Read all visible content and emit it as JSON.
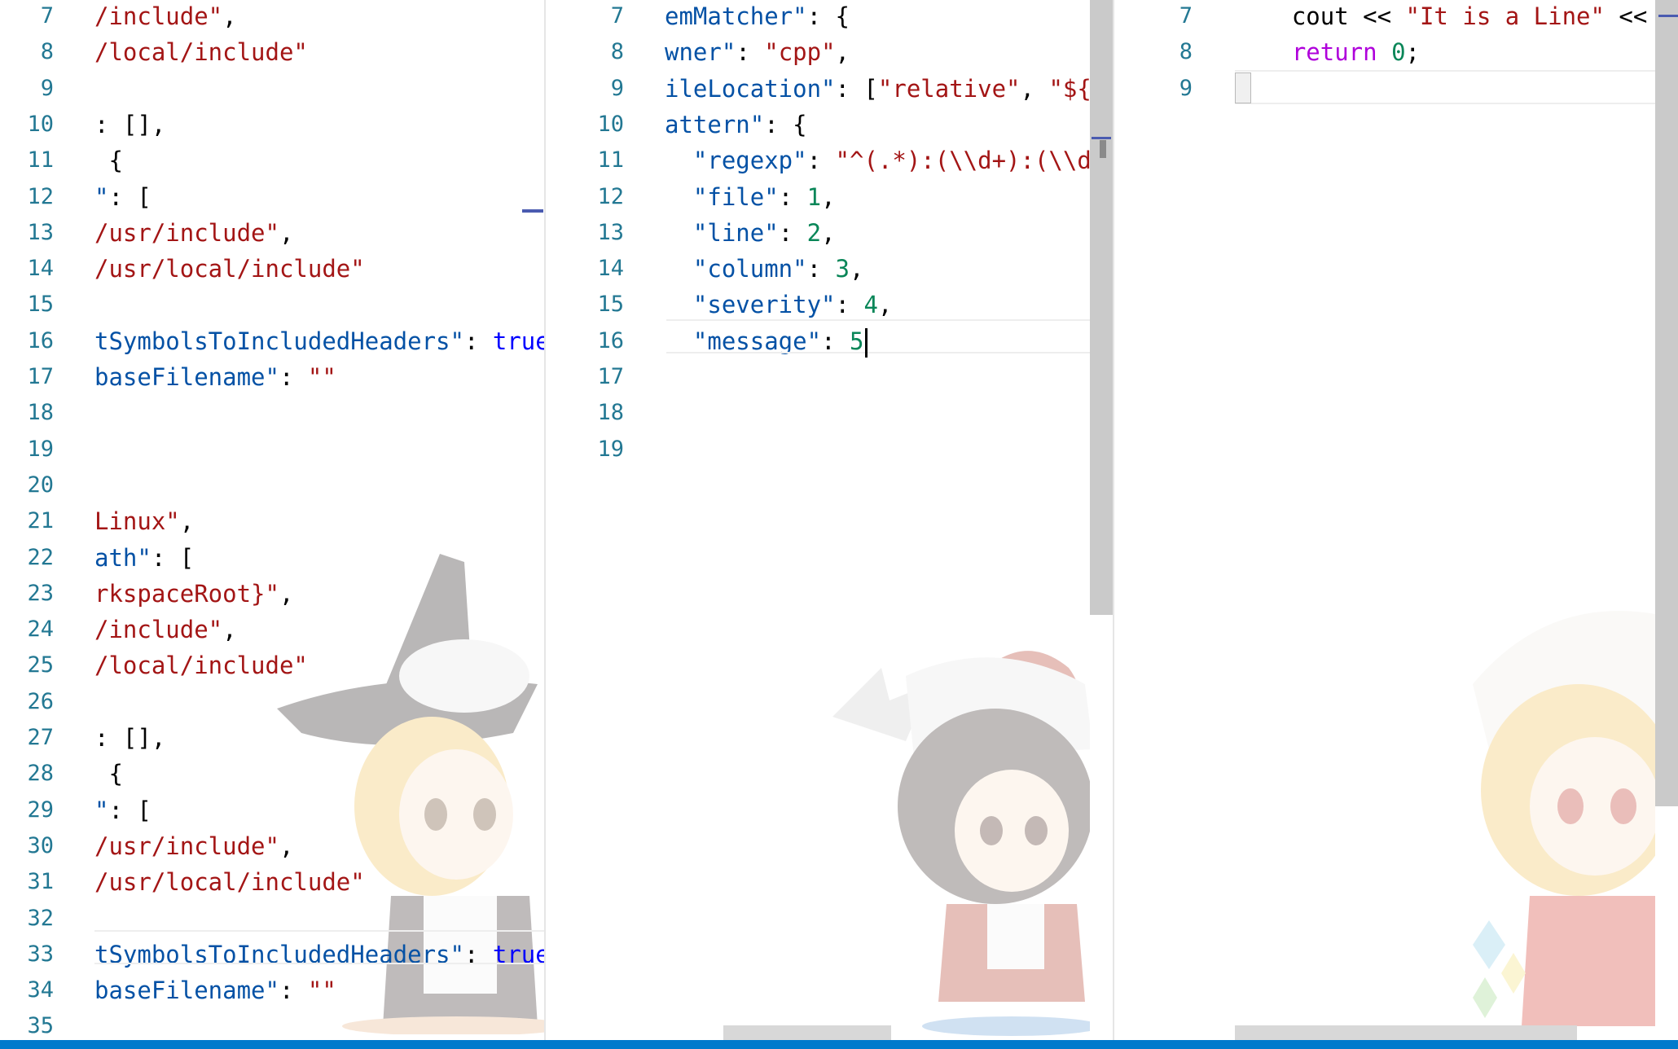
{
  "editor": {
    "colors": {
      "line_number": "#237893",
      "json_key": "#0451a5",
      "string": "#a31515",
      "number": "#098658",
      "keyword": "#0000ff",
      "control": "#af00db",
      "status_bar": "#007acc"
    },
    "panes": [
      {
        "name": "left",
        "lines": [
          {
            "n": "7",
            "parts": [
              {
                "t": "/include\"",
                "c": "str"
              },
              {
                "t": ","
              }
            ]
          },
          {
            "n": "8",
            "parts": [
              {
                "t": "/local/include\"",
                "c": "str"
              }
            ]
          },
          {
            "n": "9",
            "parts": []
          },
          {
            "n": "10",
            "parts": [
              {
                "t": ": [],"
              }
            ]
          },
          {
            "n": "11",
            "parts": [
              {
                "t": " {"
              }
            ]
          },
          {
            "n": "12",
            "parts": [
              {
                "t": "\"",
                "c": "blue"
              },
              {
                "t": ": ["
              }
            ]
          },
          {
            "n": "13",
            "parts": [
              {
                "t": "/usr/include\"",
                "c": "str"
              },
              {
                "t": ","
              }
            ]
          },
          {
            "n": "14",
            "parts": [
              {
                "t": "/usr/local/include\"",
                "c": "str"
              }
            ]
          },
          {
            "n": "15",
            "parts": []
          },
          {
            "n": "16",
            "parts": [
              {
                "t": "tSymbolsToIncludedHeaders\"",
                "c": "blue"
              },
              {
                "t": ": "
              },
              {
                "t": "true",
                "c": "kw"
              }
            ]
          },
          {
            "n": "17",
            "parts": [
              {
                "t": "baseFilename\"",
                "c": "blue"
              },
              {
                "t": ": "
              },
              {
                "t": "\"\"",
                "c": "str"
              }
            ]
          },
          {
            "n": "18",
            "parts": []
          },
          {
            "n": "19",
            "parts": []
          },
          {
            "n": "20",
            "parts": []
          },
          {
            "n": "21",
            "parts": [
              {
                "t": "Linux\"",
                "c": "str"
              },
              {
                "t": ","
              }
            ]
          },
          {
            "n": "22",
            "parts": [
              {
                "t": "ath\"",
                "c": "blue"
              },
              {
                "t": ": ["
              }
            ]
          },
          {
            "n": "23",
            "parts": [
              {
                "t": "rkspaceRoot}\"",
                "c": "str"
              },
              {
                "t": ","
              }
            ]
          },
          {
            "n": "24",
            "parts": [
              {
                "t": "/include\"",
                "c": "str"
              },
              {
                "t": ","
              }
            ]
          },
          {
            "n": "25",
            "parts": [
              {
                "t": "/local/include\"",
                "c": "str"
              }
            ]
          },
          {
            "n": "26",
            "parts": []
          },
          {
            "n": "27",
            "parts": [
              {
                "t": ": [],"
              }
            ]
          },
          {
            "n": "28",
            "parts": [
              {
                "t": " {"
              }
            ]
          },
          {
            "n": "29",
            "parts": [
              {
                "t": "\"",
                "c": "blue"
              },
              {
                "t": ": ["
              }
            ]
          },
          {
            "n": "30",
            "parts": [
              {
                "t": "/usr/include\"",
                "c": "str"
              },
              {
                "t": ","
              }
            ]
          },
          {
            "n": "31",
            "parts": [
              {
                "t": "/usr/local/include\"",
                "c": "str"
              }
            ]
          },
          {
            "n": "32",
            "parts": []
          },
          {
            "n": "33",
            "parts": [
              {
                "t": "tSymbolsToIncludedHeaders\"",
                "c": "blue"
              },
              {
                "t": ": "
              },
              {
                "t": "true",
                "c": "kw"
              }
            ]
          },
          {
            "n": "34",
            "parts": [
              {
                "t": "baseFilename\"",
                "c": "blue"
              },
              {
                "t": ": "
              },
              {
                "t": "\"\"",
                "c": "str"
              }
            ]
          },
          {
            "n": "35",
            "parts": []
          }
        ]
      },
      {
        "name": "middle",
        "lines": [
          {
            "n": "7",
            "parts": [
              {
                "t": "emMatcher\"",
                "c": "blue"
              },
              {
                "t": ": {"
              }
            ]
          },
          {
            "n": "8",
            "parts": [
              {
                "t": "wner\"",
                "c": "blue"
              },
              {
                "t": ": "
              },
              {
                "t": "\"cpp\"",
                "c": "str"
              },
              {
                "t": ","
              }
            ]
          },
          {
            "n": "9",
            "parts": [
              {
                "t": "ileLocation\"",
                "c": "blue"
              },
              {
                "t": ": ["
              },
              {
                "t": "\"relative\"",
                "c": "str"
              },
              {
                "t": ", "
              },
              {
                "t": "\"${wo",
                "c": "str"
              }
            ]
          },
          {
            "n": "10",
            "parts": [
              {
                "t": "attern\"",
                "c": "blue"
              },
              {
                "t": ": {"
              }
            ]
          },
          {
            "n": "11",
            "parts": [
              {
                "t": "  \"regexp\"",
                "c": "blue"
              },
              {
                "t": ": "
              },
              {
                "t": "\"^(.*):(\\\\d+):(\\\\d+)",
                "c": "str"
              }
            ]
          },
          {
            "n": "12",
            "parts": [
              {
                "t": "  \"file\"",
                "c": "blue"
              },
              {
                "t": ": "
              },
              {
                "t": "1",
                "c": "num"
              },
              {
                "t": ","
              }
            ]
          },
          {
            "n": "13",
            "parts": [
              {
                "t": "  \"line\"",
                "c": "blue"
              },
              {
                "t": ": "
              },
              {
                "t": "2",
                "c": "num"
              },
              {
                "t": ","
              }
            ]
          },
          {
            "n": "14",
            "parts": [
              {
                "t": "  \"column\"",
                "c": "blue"
              },
              {
                "t": ": "
              },
              {
                "t": "3",
                "c": "num"
              },
              {
                "t": ","
              }
            ]
          },
          {
            "n": "15",
            "parts": [
              {
                "t": "  \"severity\"",
                "c": "blue"
              },
              {
                "t": ": "
              },
              {
                "t": "4",
                "c": "num"
              },
              {
                "t": ","
              }
            ]
          },
          {
            "n": "16",
            "parts": [
              {
                "t": "  \"message\"",
                "c": "blue"
              },
              {
                "t": ": "
              },
              {
                "t": "5",
                "c": "num"
              }
            ]
          },
          {
            "n": "17",
            "parts": []
          },
          {
            "n": "18",
            "parts": []
          },
          {
            "n": "19",
            "parts": []
          }
        ]
      },
      {
        "name": "right",
        "lines": [
          {
            "n": "7",
            "parts": [
              {
                "t": "    cout << "
              },
              {
                "t": "\"It is a Line\"",
                "c": "str"
              },
              {
                "t": " << e"
              }
            ]
          },
          {
            "n": "8",
            "parts": [
              {
                "t": "    "
              },
              {
                "t": "return",
                "c": "ctrl"
              },
              {
                "t": " "
              },
              {
                "t": "0",
                "c": "num"
              },
              {
                "t": ";"
              }
            ]
          },
          {
            "n": "9",
            "parts": [
              {
                "t": "}"
              }
            ]
          }
        ]
      }
    ]
  }
}
